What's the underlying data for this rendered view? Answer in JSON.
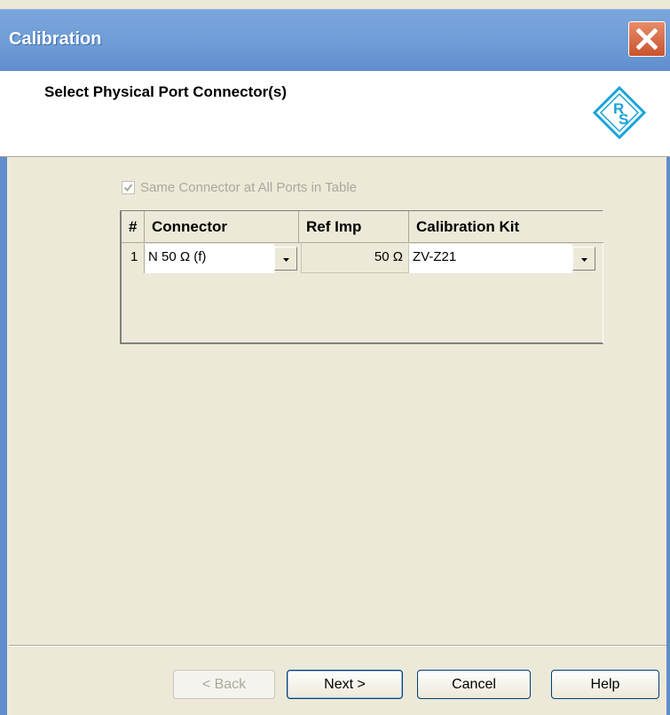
{
  "window": {
    "title": "Calibration",
    "close_icon": "close-icon"
  },
  "header": {
    "title": "Select Physical Port Connector(s)",
    "logo_text": "R S"
  },
  "options": {
    "same_connector_label": "Same Connector at All Ports in Table",
    "same_connector_checked": true,
    "same_connector_enabled": false
  },
  "table": {
    "headers": [
      "#",
      "Connector",
      "Ref Imp",
      "Calibration Kit"
    ],
    "rows": [
      {
        "num": "1",
        "connector": "N 50 Ω (f)",
        "ref_imp": "50 Ω",
        "cal_kit": "ZV-Z21"
      }
    ]
  },
  "buttons": {
    "back": "< Back",
    "next": "Next >",
    "cancel": "Cancel",
    "help": "Help"
  },
  "colors": {
    "title_bar": "#6d9bd6",
    "dialog_bg": "#ece9d8",
    "close_button": "#d9603a",
    "logo": "#1aa3d9"
  }
}
